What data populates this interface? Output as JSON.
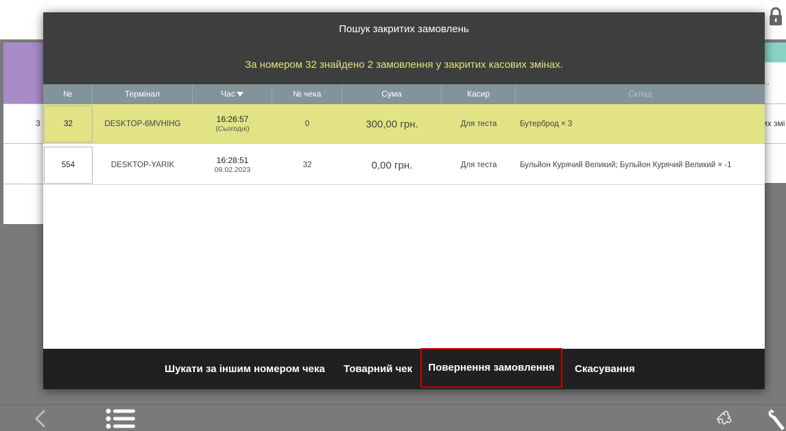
{
  "dialog": {
    "title": "Пошук закритих замовлень",
    "subtitle": "За номером 32 знайдено 2 замовлення у закритих касових змінах."
  },
  "table": {
    "columns": [
      "№",
      "Термінал",
      "Час",
      "№ чека",
      "Сума",
      "Касир",
      "Склад"
    ],
    "rows": [
      {
        "num": "32",
        "terminal": "DESKTOP-6MVHIHG",
        "time": "16:26:57",
        "date": "(Сьогодні)",
        "check": "0",
        "sum": "300,00 грн.",
        "cashier": "Для теста",
        "sklad": "Бутерброд × 3"
      },
      {
        "num": "554",
        "terminal": "DESKTOP-YARIK",
        "time": "16:28:51",
        "date": "09.02.2023",
        "check": "32",
        "sum": "0,00 грн.",
        "cashier": "Для теста",
        "sklad": "Бульйон Курячий Великий; Бульйон Курячий Великий × -1"
      }
    ]
  },
  "footer": {
    "search_other": "Шукати за іншим номером чека",
    "goods_receipt": "Товарний чек",
    "return_order": "Повернення замовлення",
    "cancel": "Скасування"
  },
  "background": {
    "left_cell": "3",
    "right_dots": "...",
    "right_text": "их змі"
  },
  "icons": {
    "lock": "lock-icon",
    "back": "chevron-left-icon",
    "menu": "list-menu-icon",
    "plugin": "puzzle-icon",
    "tools": "wrench-icon"
  },
  "colors": {
    "header_bg": "#3c3f3e",
    "subtitle": "#e5e07a",
    "table_header": "#83939a",
    "selected_row": "#e1e385",
    "footer_bg": "#202020",
    "highlight_border": "#d00000"
  }
}
